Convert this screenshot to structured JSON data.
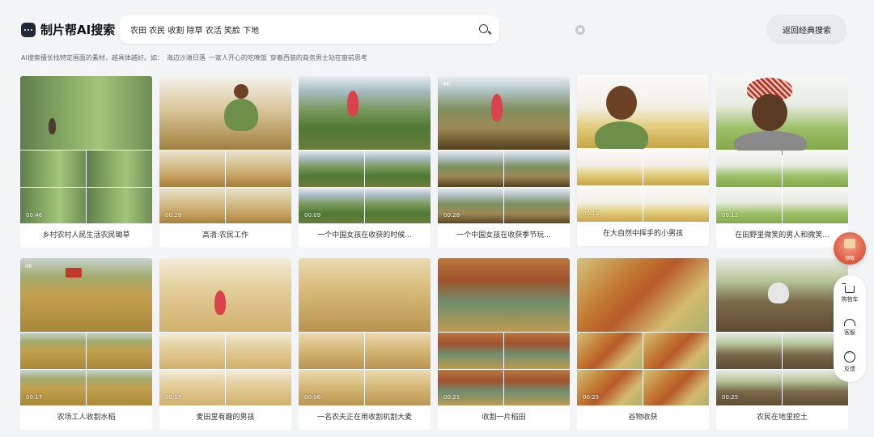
{
  "header": {
    "logo_text": "制片帮AI搜索",
    "search_value": "农田 农民 收割 除草 农活 笑脸 下地",
    "back_button_label": "返回经典搜索",
    "hint_prefix": "AI搜索擅长找特定画面的素材，越具体越好。如：",
    "hint_examples": [
      "海边沙滩日落",
      "一家人开心的吃晚饭",
      "穿着西装的商务男士站在窗前思考"
    ]
  },
  "results": [
    {
      "title": "乡村农村人民生活农民锄草",
      "duration": "00:46",
      "badge": ""
    },
    {
      "title": "高清:农民工作",
      "duration": "00:28",
      "badge": ""
    },
    {
      "title": "一个中国女孩在收获的时候...",
      "duration": "00:09",
      "badge": ""
    },
    {
      "title": "一个中国女孩在收获季节玩...",
      "duration": "00:28",
      "badge": "4K"
    },
    {
      "title": "在大自然中挥手的小男孩",
      "duration": "00:13",
      "badge": ""
    },
    {
      "title": "在田野里微笑的男人和微笑...",
      "duration": "00:12",
      "badge": ""
    },
    {
      "title": "农场工人收割水稻",
      "duration": "00:17",
      "badge": "4K"
    },
    {
      "title": "麦田里有趣的男孩",
      "duration": "00:17",
      "badge": ""
    },
    {
      "title": "一名农夫正在用收割机割大麦",
      "duration": "00:06",
      "badge": ""
    },
    {
      "title": "收割一片稻田",
      "duration": "00:21",
      "badge": ""
    },
    {
      "title": "谷物收获",
      "duration": "00:25",
      "badge": ""
    },
    {
      "title": "农民在地里挖土",
      "duration": "00:25",
      "badge": ""
    }
  ],
  "float": {
    "gift_label": "领取",
    "cart_label": "购物车",
    "service_label": "客服",
    "feedback_label": "反馈"
  }
}
